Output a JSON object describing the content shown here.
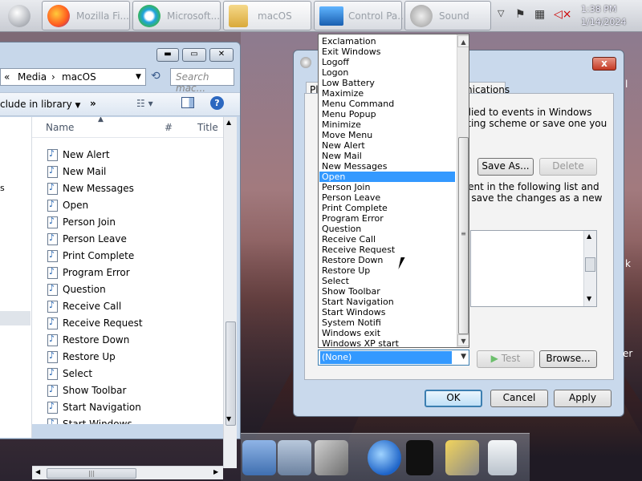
{
  "taskbar": {
    "buttons": [
      {
        "icon": "firefox-icon",
        "label": "Mozilla Fi..."
      },
      {
        "icon": "edge-icon",
        "label": "Microsoft..."
      },
      {
        "icon": "folder-icon",
        "label": "macOS"
      },
      {
        "icon": "computer-icon",
        "label": "Control Pa..."
      },
      {
        "icon": "speaker-icon",
        "label": "Sound"
      }
    ],
    "clock_time": "1:38 PM",
    "clock_date": "1/14/2024"
  },
  "explorer": {
    "breadcrumb": [
      "Media",
      "macOS"
    ],
    "search_placeholder": "Search mac...",
    "toolbar_include": "clude in library",
    "toolbar_more": "»",
    "columns": {
      "name": "Name",
      "num": "#",
      "title": "Title"
    },
    "files": [
      "New Alert",
      "New Mail",
      "New Messages",
      "Open",
      "Person Join",
      "Person Leave",
      "Print Complete",
      "Program Error",
      "Question",
      "Receive Call",
      "Receive Request",
      "Restore Down",
      "Restore Up",
      "Select",
      "Show Toolbar",
      "Start Navigation",
      "Start Windows"
    ],
    "left_fragments": [
      "s",
      "s"
    ],
    "hscroll_grip": "|||"
  },
  "dialog": {
    "tabs": [
      "Pla",
      "nications"
    ],
    "close_label": "x",
    "desc_line1": "plied to events in Windows",
    "desc_line2": "sting scheme or save one you",
    "save_as": "Save As...",
    "delete": "Delete",
    "events_line1": "vent in the following list and",
    "events_line2": "n save the changes as a new",
    "test": "Test",
    "browse": "Browse...",
    "ok": "OK",
    "cancel": "Cancel",
    "apply": "Apply",
    "side_fragments": [
      "l",
      "k",
      "er"
    ]
  },
  "dropdown": {
    "items": [
      "Exclamation",
      "Exit Windows",
      "Logoff",
      "Logon",
      "Low Battery",
      "Maximize",
      "Menu Command",
      "Menu Popup",
      "Minimize",
      "Move Menu",
      "New Alert",
      "New Mail",
      "New Messages",
      "Open",
      "Person Join",
      "Person Leave",
      "Print Complete",
      "Program Error",
      "Question",
      "Receive Call",
      "Receive Request",
      "Restore Down",
      "Restore Up",
      "Select",
      "Show Toolbar",
      "Start Navigation",
      "Start Windows",
      "System Notifi",
      "Windows exit",
      "Windows XP start"
    ],
    "selected_item": "Open",
    "selected_value": "(None)",
    "scroll_grip": "≡"
  },
  "dock": {
    "items": [
      "folder-icon",
      "folder-icon",
      "tools-icon",
      "network-icon",
      "shirt-icon",
      "wrench-icon",
      "trash-icon"
    ]
  },
  "colors": {
    "selection": "#3399ff",
    "title_bar": "#c9d9ec",
    "close_button": "#c43a24"
  }
}
